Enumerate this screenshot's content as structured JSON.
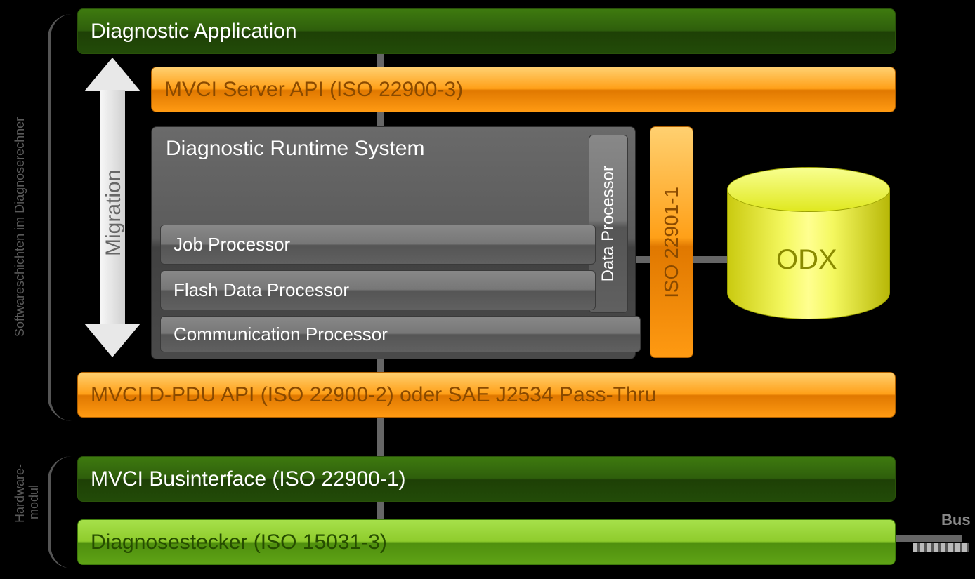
{
  "top": {
    "diagApp": "Diagnostic Application"
  },
  "api": {
    "server": "MVCI Server API (ISO 22900-3)",
    "dpdu": "MVCI D-PDU API (ISO 22900-2) oder SAE J2534 Pass-Thru"
  },
  "runtime": {
    "title": "Diagnostic Runtime System",
    "job": "Job Processor",
    "flash": "Flash Data Processor",
    "comm": "Communication Processor",
    "data": "Data Processor"
  },
  "iso229011": "ISO 22901-1",
  "odx": "ODX",
  "hw": {
    "businterface": "MVCI Businterface (ISO 22900-1)",
    "stecker": "Diagnosestecker (ISO 15031-3)"
  },
  "side": {
    "soft": "Softwareschichten im Diagnoserechner",
    "hw1": "Hardware-",
    "hw2": "modul"
  },
  "migration": "Migration",
  "bus": "Bus"
}
